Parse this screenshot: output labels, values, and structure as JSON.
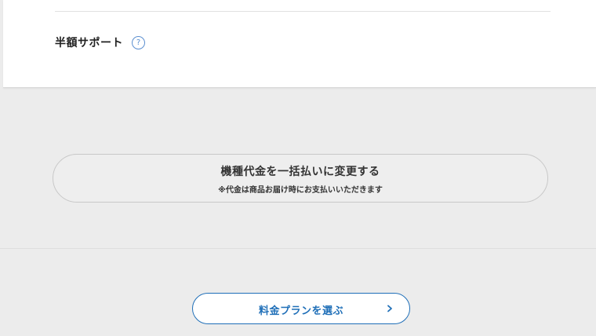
{
  "support": {
    "label": "半額サポート",
    "help_icon": "?"
  },
  "lump_sum": {
    "title": "機種代金を一括払いに変更する",
    "note": "※代金は商品お届け時にお支払いいただきます"
  },
  "plan": {
    "label": "料金プランを選ぶ",
    "chevron_icon": "chevron-right-icon"
  },
  "colors": {
    "accent": "#1f6fb8",
    "help_icon": "#5b8fd0",
    "background": "#ececec"
  }
}
